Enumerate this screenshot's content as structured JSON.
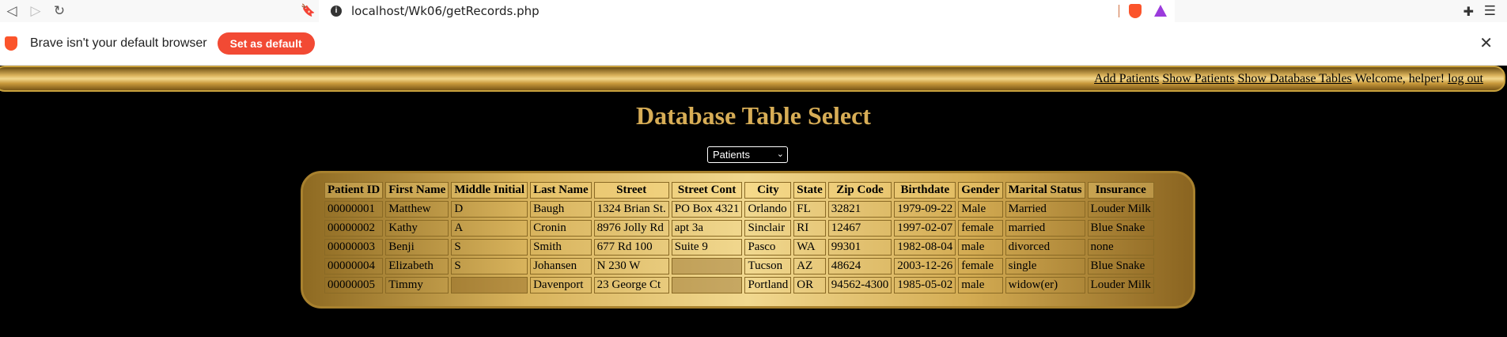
{
  "browser": {
    "url": "localhost/Wk06/getRecords.php"
  },
  "infobar": {
    "message": "Brave isn't your default browser",
    "button": "Set as default"
  },
  "nav": {
    "add_patients": "Add Patients",
    "show_patients": "Show Patients",
    "show_tables": "Show Database Tables",
    "welcome": "Welcome, helper!",
    "logout": "log out"
  },
  "page": {
    "title": "Database Table Select",
    "select_value": "Patients"
  },
  "table": {
    "headers": [
      "Patient ID",
      "First Name",
      "Middle Initial",
      "Last Name",
      "Street",
      "Street Cont",
      "City",
      "State",
      "Zip Code",
      "Birthdate",
      "Gender",
      "Marital Status",
      "Insurance"
    ],
    "rows": [
      [
        "00000001",
        "Matthew",
        "D",
        "Baugh",
        "1324 Brian St.",
        "PO Box 4321",
        "Orlando",
        "FL",
        "32821",
        "1979-09-22",
        "Male",
        "Married",
        "Louder Milk"
      ],
      [
        "00000002",
        "Kathy",
        "A",
        "Cronin",
        "8976 Jolly Rd",
        "apt 3a",
        "Sinclair",
        "RI",
        "12467",
        "1997-02-07",
        "female",
        "married",
        "Blue Snake"
      ],
      [
        "00000003",
        "Benji",
        "S",
        "Smith",
        "677 Rd 100",
        "Suite 9",
        "Pasco",
        "WA",
        "99301",
        "1982-08-04",
        "male",
        "divorced",
        "none"
      ],
      [
        "00000004",
        "Elizabeth",
        "S",
        "Johansen",
        "N 230 W",
        "",
        "Tucson",
        "AZ",
        "48624",
        "2003-12-26",
        "female",
        "single",
        "Blue Snake"
      ],
      [
        "00000005",
        "Timmy",
        "",
        "Davenport",
        "23 George Ct",
        "",
        "Portland",
        "OR",
        "94562-4300",
        "1985-05-02",
        "male",
        "widow(er)",
        "Louder Milk"
      ]
    ]
  }
}
